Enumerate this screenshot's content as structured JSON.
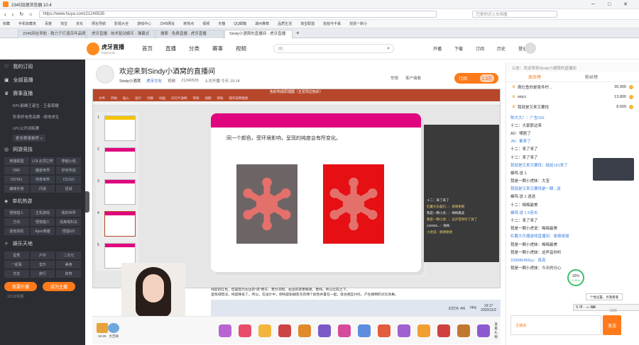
{
  "browser": {
    "title": "2345加速浏览器 10.4",
    "url": "https://www.huya.com/21240535",
    "search_placeholder": "巴黎附近火车相撞",
    "bookmarks": [
      "收藏",
      "手机收藏夹",
      "百度",
      "淘宝",
      "京东",
      "网址导航",
      "影视大全",
      "游戏中心",
      "2345网址",
      "新热点",
      "视频",
      "天猫",
      "QQ邮箱",
      "湖州推荐",
      "品质生活",
      "淘宝联盟",
      "拍拍今不丢",
      "找贤一新小"
    ],
    "tabs": [
      "2345网址导航 - 致力于打造百年品牌",
      "虎牙直播 - 技术驱动娱乐 - 弹幕式",
      "搜索 - 免费直播 - 虎牙直播",
      "Sindy小酒窝的直播间 - 虎牙直播"
    ]
  },
  "site": {
    "logo_text": "虎牙直播",
    "logo_sub": "huya.com",
    "nav": [
      "首页",
      "直播",
      "分类",
      "赛事",
      "视频"
    ],
    "search_placeholder": "同",
    "header_right": [
      "开播",
      "下载",
      "订阅",
      "历史",
      "登录"
    ]
  },
  "sidebar": {
    "items": [
      {
        "label": "我的订阅"
      },
      {
        "label": "全部直播"
      },
      {
        "label": "赛事直播"
      }
    ],
    "events": [
      "KPL巅峰王者生 - 王者荣耀",
      "秒表杯电竞高赛 - 绝地求生",
      "LPL公开训练赛"
    ],
    "more_events": "更多赛事推荐 >",
    "sec_online": "网游竞技",
    "online_tags": [
      "英雄联盟",
      "LOL云顶之弈",
      "穿越火线",
      "DNF",
      "魔兽世界",
      "炉石传说",
      "DOTA1",
      "传奇世界",
      "CS:GO",
      "魔域手游",
      "问道",
      "逆战"
    ],
    "sec_single": "单机热游",
    "single_tags": [
      "怪物猎人",
      "主机游戏",
      "我的世界",
      "方舟",
      "怪物猎人",
      "逃离塔科夫",
      "其他单机",
      "Apex英雄",
      "怪猎GO"
    ],
    "sec_ent": "娱乐天地",
    "ent_tags": [
      "星秀",
      "户外",
      "二次元",
      "一起看",
      "音乐",
      "美食",
      "交友",
      "旅行",
      "体育"
    ],
    "btn_open": "我要开播",
    "btn_host": "成为主播",
    "footer": "12118举报"
  },
  "room": {
    "title": "欢迎来到Sindy小酒窝的直播间",
    "host": "Sindy小酒窝",
    "tags": [
      "虎牙文化",
      "视频",
      "21240535",
      "上次开播 今天 19:14"
    ],
    "subscribe": "订阅",
    "fans": "1.3万",
    "report": "举报",
    "share": "客户端看"
  },
  "ppt": {
    "ribbon_tabs": [
      "文件",
      "开始",
      "插入",
      "设计",
      "切换",
      "动画",
      "幻灯片放映",
      "审阅",
      "视图",
      "帮助",
      "操作说明搜索"
    ],
    "title_bar": "色彩构成原理图（五至周边色彩）",
    "slide_text": "同一个颜色，受环境影响，呈现的纯度会有所变化。",
    "notes": "纯度的红色。但是因为左边的\"底\"更灰、更为深暗，右边的底更鲜艳、更纯，所以比较之下，",
    "notes2": "呈现得暗淡，纯度降低了。所以，在设计中，把纯度削弱变灰的两个颜色并置在一起，就会相互衬托，产生鲜明的对比效果。",
    "page": "幻灯片 4/6",
    "zoom": "74%",
    "time": "19:17",
    "date": "2020/11/2",
    "thumb_nums": [
      "1",
      "2",
      "3",
      "4",
      "5"
    ],
    "chat_lines": [
      "十二：来了来了",
      "红戴大乐器们...：谢谢谢谢",
      "我是一颗小虎...：梅梅最美",
      "我是一颗小虎...：这声音你听了放了",
      "230085...：梅梅",
      "小虎说：谢谢谢谢"
    ]
  },
  "chat": {
    "announce": "公告：欢迎来到Sindy小酒窝的直播间",
    "tabs": [
      "周贡榜",
      "粉丝榜"
    ],
    "rank": [
      {
        "name": "周仕鱼你是阜件柠...",
        "value": "30,900"
      },
      {
        "name": "wqcc",
        "value": "13,800"
      },
      {
        "name": "我就是又来又要找",
        "value": "8,600"
      }
    ],
    "messages": [
      "陈大大！：广告192",
      "十二：大家那边来",
      "A0：嘴唇了",
      "JN：都来了",
      "十二：来了来了",
      "十二：来了来了",
      "我就是又来又要找：投给191来了",
      "蜂鸣 送 1",
      "我是一颗小虎妹：大宝",
      "我就是又来又要找是一颗...送",
      "蜂鸣 送 1 送送",
      "十二：梅梅最美",
      "蜂鸣 送 1 5连击",
      "十二：来了来了",
      "我是一颗小虎说：梅梅最美",
      "红戴大乐器游戏直播间：谢谢谢谢",
      "我是一颗小虎妹：梅梅最美",
      "我是一颗小虎妹：这声音你听",
      "230085459yy：真亮",
      "我是一颗小虎妹：今天的分心"
    ],
    "progress_text": "32%",
    "progress_sub": "0.3K/s",
    "tooltip": "个性设置，点我看看",
    "input_placeholder": "主播说",
    "send": "发送",
    "count": "0/30"
  },
  "gifts": {
    "treasure_label": "04:25",
    "city": "大吉祥",
    "lottery": "查看礼物",
    "gift_colors": [
      "#b865d3",
      "#e84d6b",
      "#f3b53c",
      "#c44",
      "#e08a2c",
      "#7a59c8",
      "#d64b9a",
      "#5e8de0",
      "#e35c3b",
      "#a060d0",
      "#f0a030",
      "#d04040",
      "#c07830",
      "#8c5ad0"
    ]
  },
  "colors": {
    "accent": "#ff7a1a",
    "nav_bg": "#2b2d33",
    "slide_pink": "#e0067f",
    "red": "#e60f14",
    "gray_box": "#6d6565"
  }
}
